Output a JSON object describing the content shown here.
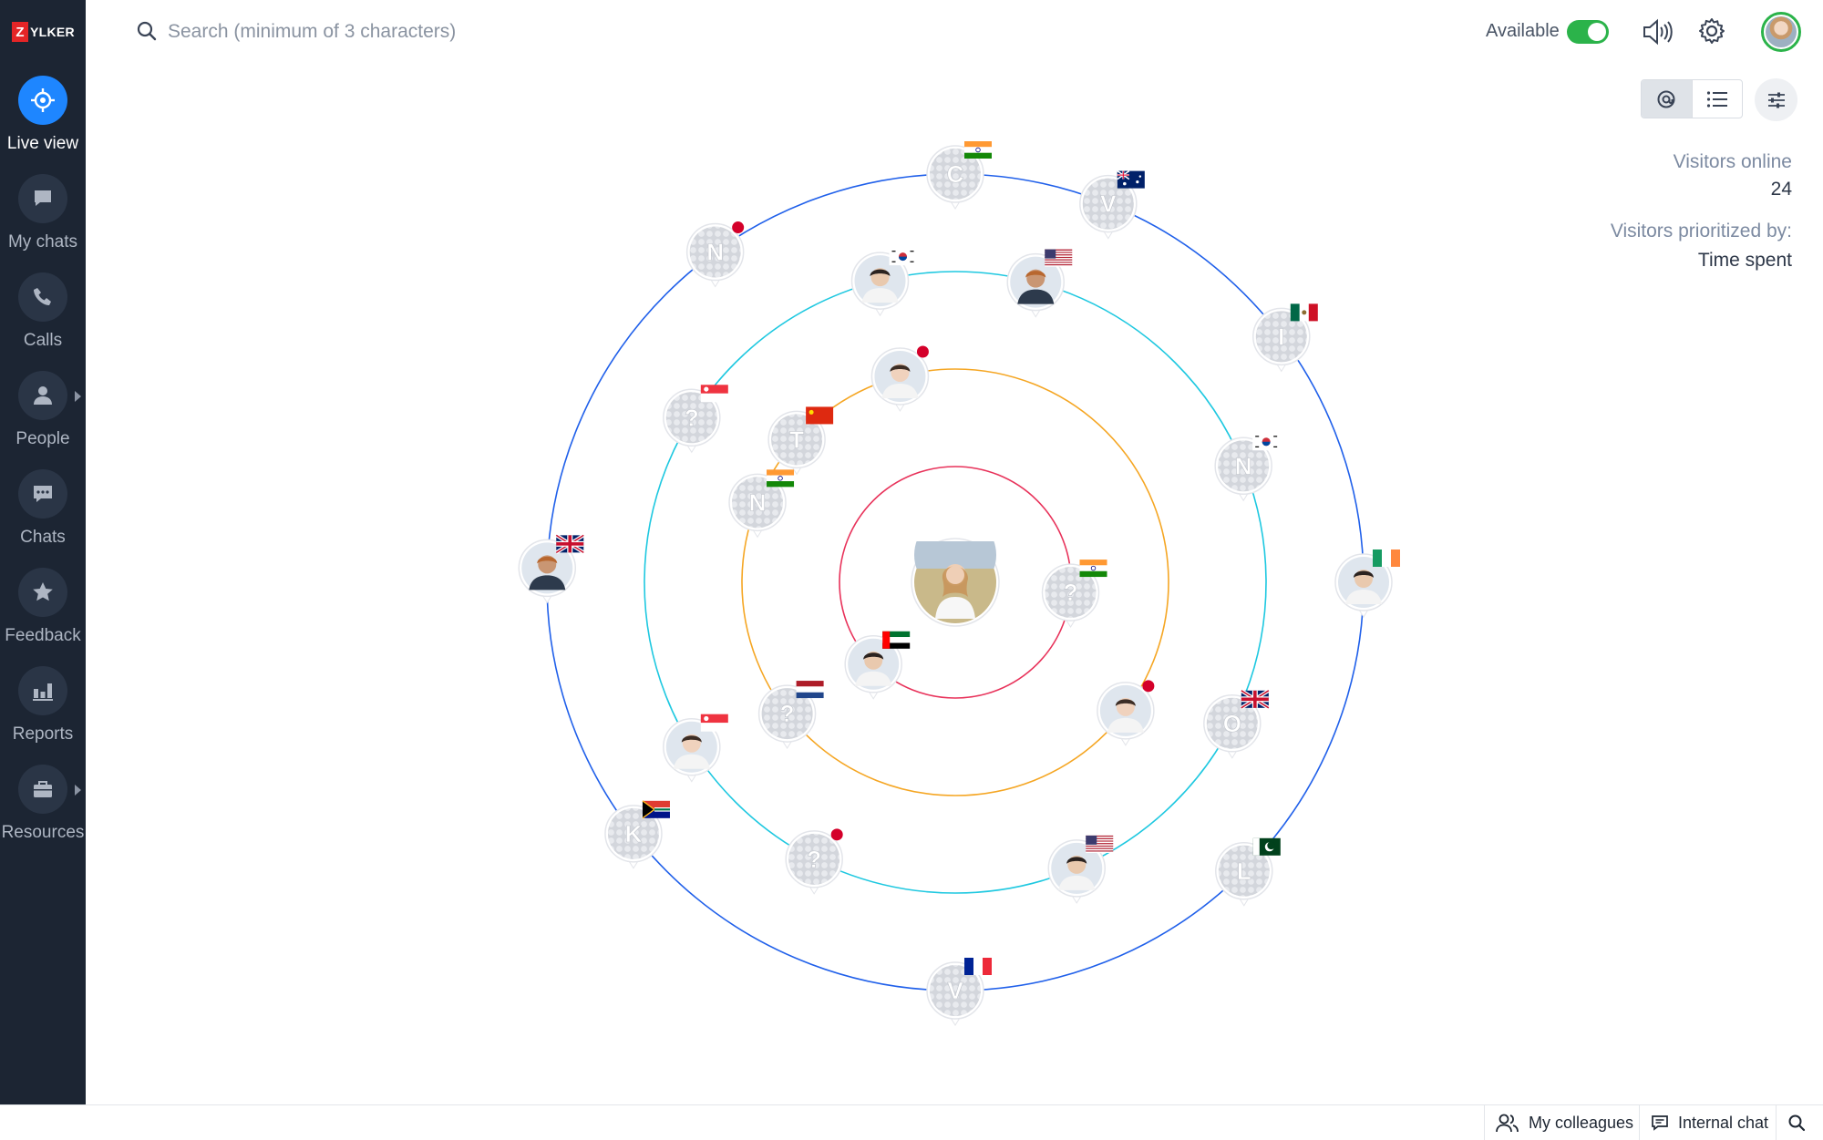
{
  "brand": {
    "logo_mark": "Z",
    "logo_word": "YLKER"
  },
  "sidebar": {
    "items": [
      {
        "label": "Live view",
        "icon": "crosshair-icon",
        "active": true
      },
      {
        "label": "My chats",
        "icon": "chat-bubble-icon"
      },
      {
        "label": "Calls",
        "icon": "phone-icon"
      },
      {
        "label": "People",
        "icon": "person-icon",
        "has_submenu": true
      },
      {
        "label": "Chats",
        "icon": "chat-dots-icon"
      },
      {
        "label": "Feedback",
        "icon": "star-icon"
      },
      {
        "label": "Reports",
        "icon": "bar-chart-icon"
      },
      {
        "label": "Resources",
        "icon": "briefcase-icon",
        "has_submenu": true
      }
    ]
  },
  "header": {
    "search_placeholder": "Search (minimum of 3 characters)",
    "status_label": "Available",
    "status_on": true
  },
  "panel": {
    "visitors_online_label": "Visitors online",
    "visitors_online_value": "24",
    "prioritized_label": "Visitors prioritized by:",
    "prioritized_value": "Time spent"
  },
  "orbit": {
    "ring_colors": [
      "#e8325a",
      "#f5a623",
      "#1ec8e0",
      "#2060ea"
    ],
    "center": "operator",
    "visitors": [
      {
        "ring": 0,
        "angle": 225,
        "type": "photo",
        "flag": "ae"
      },
      {
        "ring": 0,
        "angle": 355,
        "type": "letter",
        "letter": "?",
        "flag": "in"
      },
      {
        "ring": 1,
        "angle": 105,
        "type": "photo",
        "flag": "jp"
      },
      {
        "ring": 1,
        "angle": 138,
        "type": "letter",
        "letter": "T",
        "flag": "cn"
      },
      {
        "ring": 1,
        "angle": 158,
        "type": "letter",
        "letter": "N",
        "flag": "in"
      },
      {
        "ring": 1,
        "angle": 218,
        "type": "letter",
        "letter": "?",
        "flag": "nl"
      },
      {
        "ring": 1,
        "angle": 323,
        "type": "photo",
        "flag": "jp"
      },
      {
        "ring": 2,
        "angle": 75,
        "type": "photo",
        "flag": "us"
      },
      {
        "ring": 2,
        "angle": 104,
        "type": "photo",
        "flag": "kr"
      },
      {
        "ring": 2,
        "angle": 148,
        "type": "letter",
        "letter": "?",
        "flag": "sg"
      },
      {
        "ring": 2,
        "angle": 212,
        "type": "photo",
        "flag": "sg"
      },
      {
        "ring": 2,
        "angle": 243,
        "type": "letter",
        "letter": "?",
        "flag": "jp"
      },
      {
        "ring": 2,
        "angle": 293,
        "type": "photo",
        "flag": "us"
      },
      {
        "ring": 2,
        "angle": 333,
        "type": "letter",
        "letter": "O",
        "flag": "gb"
      },
      {
        "ring": 2,
        "angle": 22,
        "type": "letter",
        "letter": "N",
        "flag": "kr"
      },
      {
        "ring": 3,
        "angle": 90,
        "type": "letter",
        "letter": "C",
        "flag": "in"
      },
      {
        "ring": 3,
        "angle": 126,
        "type": "letter",
        "letter": "N",
        "flag": "jp"
      },
      {
        "ring": 3,
        "angle": 68,
        "type": "letter",
        "letter": "V",
        "flag": "au"
      },
      {
        "ring": 3,
        "angle": 37,
        "type": "letter",
        "letter": "I",
        "flag": "mx"
      },
      {
        "ring": 3,
        "angle": 178,
        "type": "photo",
        "flag": "gb"
      },
      {
        "ring": 3,
        "angle": 0,
        "type": "photo",
        "flag": "ie"
      },
      {
        "ring": 3,
        "angle": 218,
        "type": "letter",
        "letter": "K",
        "flag": "za"
      },
      {
        "ring": 3,
        "angle": 270,
        "type": "letter",
        "letter": "V",
        "flag": "fr"
      },
      {
        "ring": 3,
        "angle": 315,
        "type": "letter",
        "letter": "L",
        "flag": "pk"
      }
    ]
  },
  "bottom_bar": {
    "colleagues_label": "My colleagues",
    "internal_chat_label": "Internal chat"
  }
}
